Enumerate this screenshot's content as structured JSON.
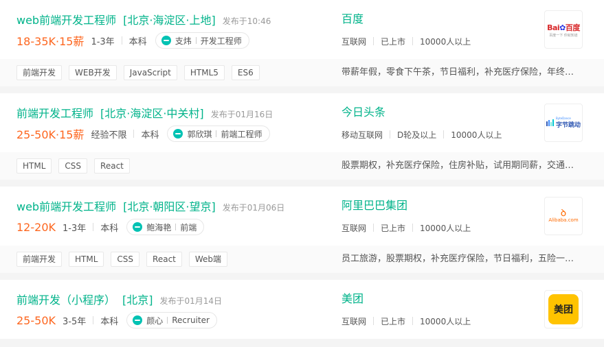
{
  "jobs": [
    {
      "title": "web前端开发工程师",
      "city": "[北京·海淀区·上地]",
      "published": "发布于10:46",
      "salary": "18-35K·15薪",
      "experience": "1-3年",
      "education": "本科",
      "hr_name": "支炜",
      "hr_title": "开发工程师",
      "company": "百度",
      "industry": "互联网",
      "stage": "已上市",
      "size": "10000人以上",
      "logo": {
        "name": "baidu-logo",
        "text_main": "Bai",
        "text_paw": "du",
        "text_cn": "百度",
        "text_sub": "百度一下 你就知道"
      },
      "tags": [
        "前端开发",
        "WEB开发",
        "JavaScript",
        "HTML5",
        "ES6"
      ],
      "welfare": "带薪年假，零食下午茶，节日福利，补充医疗保险，年终…"
    },
    {
      "title": "前端开发工程师",
      "city": "[北京·海淀区·中关村]",
      "published": "发布于01月16日",
      "salary": "25-50K·15薪",
      "experience": "经验不限",
      "education": "本科",
      "hr_name": "郭欣琪",
      "hr_title": "前端工程师",
      "company": "今日头条",
      "industry": "移动互联网",
      "stage": "D轮及以上",
      "size": "10000人以上",
      "logo": {
        "name": "bytedance-logo",
        "text": "字节跳动",
        "text_small": "ByteDance"
      },
      "tags": [
        "HTML",
        "CSS",
        "React"
      ],
      "welfare": "股票期权，补充医疗保险，住房补贴，试用期同薪，交通…"
    },
    {
      "title": "web前端开发工程师",
      "city": "[北京·朝阳区·望京]",
      "published": "发布于01月06日",
      "salary": "12-20K",
      "experience": "1-3年",
      "education": "本科",
      "hr_name": "鲍海艳",
      "hr_title": "前端",
      "company": "阿里巴巴集团",
      "industry": "互联网",
      "stage": "已上市",
      "size": "10000人以上",
      "logo": {
        "name": "alibaba-logo",
        "text": "Alibaba.com"
      },
      "tags": [
        "前端开发",
        "HTML",
        "CSS",
        "React",
        "Web端"
      ],
      "welfare": "员工旅游，股票期权，补充医疗保险，节日福利，五险一…"
    },
    {
      "title": "前端开发（小程序）",
      "city": "[北京]",
      "published": "发布于01月14日",
      "salary": "25-50K",
      "experience": "3-5年",
      "education": "本科",
      "hr_name": "颜心",
      "hr_title": "Recruiter",
      "company": "美团",
      "industry": "互联网",
      "stage": "已上市",
      "size": "10000人以上",
      "logo": {
        "name": "meituan-logo",
        "text": "美团"
      },
      "tags": [],
      "welfare": ""
    }
  ],
  "colors": {
    "accent": "#00b38a",
    "salary": "#fd661f",
    "hr_icon": "#00c2b3"
  }
}
